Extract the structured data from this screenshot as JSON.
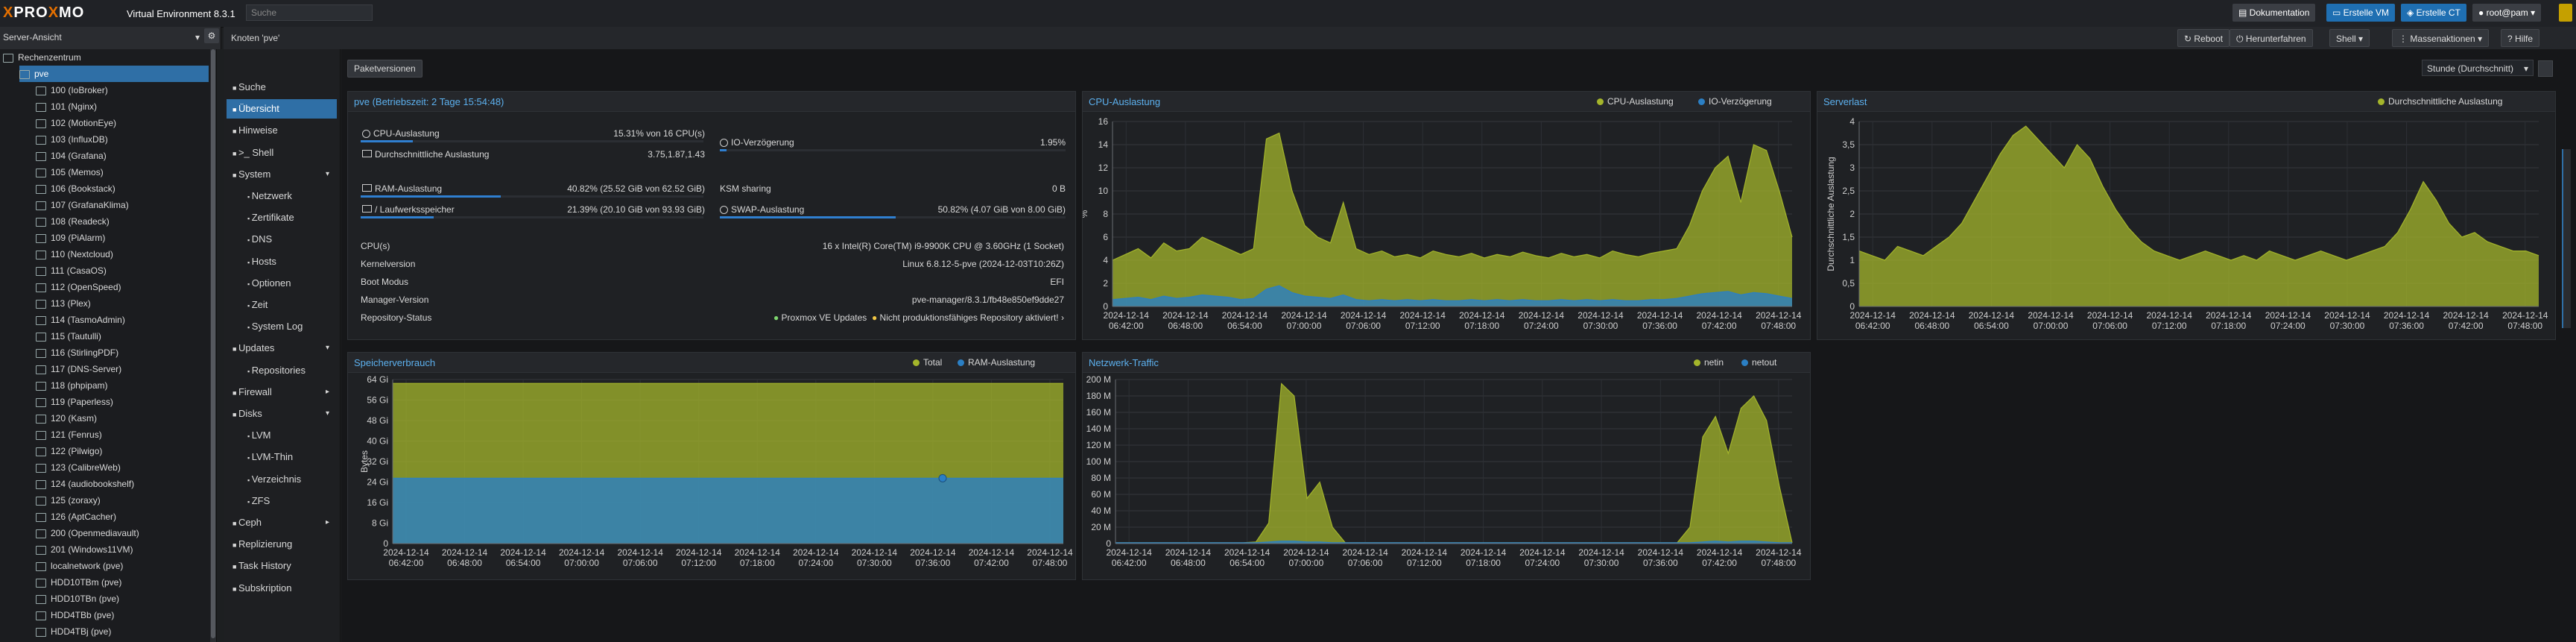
{
  "header": {
    "logo_left": "PRO",
    "logo_x": "X",
    "logo_right": "MO",
    "logo_x2": "X",
    "version": "Virtual Environment 8.3.1",
    "search_placeholder": "Suche",
    "docs": "Dokumentation",
    "create_vm": "Erstelle VM",
    "create_ct": "Erstelle CT",
    "user": "root@pam",
    "view": "Server-Ansicht"
  },
  "tree": [
    {
      "label": "Rechenzentrum",
      "indent": 0
    },
    {
      "label": "pve",
      "indent": 1,
      "selected": true
    },
    {
      "label": "100 (IoBroker)",
      "indent": 2
    },
    {
      "label": "101 (Nginx)",
      "indent": 2
    },
    {
      "label": "102 (MotionEye)",
      "indent": 2
    },
    {
      "label": "103 (InfluxDB)",
      "indent": 2
    },
    {
      "label": "104 (Grafana)",
      "indent": 2
    },
    {
      "label": "105 (Memos)",
      "indent": 2
    },
    {
      "label": "106 (Bookstack)",
      "indent": 2
    },
    {
      "label": "107 (GrafanaKlima)",
      "indent": 2
    },
    {
      "label": "108 (Readeck)",
      "indent": 2
    },
    {
      "label": "109 (PiAlarm)",
      "indent": 2
    },
    {
      "label": "110 (Nextcloud)",
      "indent": 2
    },
    {
      "label": "111 (CasaOS)",
      "indent": 2
    },
    {
      "label": "112 (OpenSpeed)",
      "indent": 2
    },
    {
      "label": "113 (Plex)",
      "indent": 2
    },
    {
      "label": "114 (TasmoAdmin)",
      "indent": 2
    },
    {
      "label": "115 (Tautulli)",
      "indent": 2
    },
    {
      "label": "116 (StirlingPDF)",
      "indent": 2
    },
    {
      "label": "117 (DNS-Server)",
      "indent": 2
    },
    {
      "label": "118 (phpipam)",
      "indent": 2
    },
    {
      "label": "119 (Paperless)",
      "indent": 2
    },
    {
      "label": "120 (Kasm)",
      "indent": 2
    },
    {
      "label": "121 (Fenrus)",
      "indent": 2
    },
    {
      "label": "122 (Pilwigo)",
      "indent": 2
    },
    {
      "label": "123 (CalibreWeb)",
      "indent": 2
    },
    {
      "label": "124 (audiobookshelf)",
      "indent": 2
    },
    {
      "label": "125 (zoraxy)",
      "indent": 2
    },
    {
      "label": "126 (AptCacher)",
      "indent": 2
    },
    {
      "label": "200 (Openmediavault)",
      "indent": 2
    },
    {
      "label": "201 (Windows11VM)",
      "indent": 2
    },
    {
      "label": "localnetwork (pve)",
      "indent": 2
    },
    {
      "label": "HDD10TBm (pve)",
      "indent": 2
    },
    {
      "label": "HDD10TBn (pve)",
      "indent": 2
    },
    {
      "label": "HDD4TBb (pve)",
      "indent": 2
    },
    {
      "label": "HDD4TBj (pve)",
      "indent": 2
    }
  ],
  "nodebar": {
    "title": "Knoten 'pve'",
    "reboot": "Reboot",
    "shutdown": "Herunterfahren",
    "shell": "Shell",
    "bulk": "Massenaktionen",
    "help": "Hilfe"
  },
  "nav": [
    {
      "label": "Suche",
      "sub": false
    },
    {
      "label": "Übersicht",
      "sub": false,
      "selected": true
    },
    {
      "label": "Hinweise",
      "sub": false
    },
    {
      "label": ">_ Shell",
      "sub": false
    },
    {
      "label": "System",
      "sub": false,
      "arrow": "▾"
    },
    {
      "label": "Netzwerk",
      "sub": true
    },
    {
      "label": "Zertifikate",
      "sub": true
    },
    {
      "label": "DNS",
      "sub": true
    },
    {
      "label": "Hosts",
      "sub": true
    },
    {
      "label": "Optionen",
      "sub": true
    },
    {
      "label": "Zeit",
      "sub": true
    },
    {
      "label": "System Log",
      "sub": true
    },
    {
      "label": "Updates",
      "sub": false,
      "arrow": "▾"
    },
    {
      "label": "Repositories",
      "sub": true
    },
    {
      "label": "Firewall",
      "sub": false,
      "arrow": "▸"
    },
    {
      "label": "Disks",
      "sub": false,
      "arrow": "▾"
    },
    {
      "label": "LVM",
      "sub": true
    },
    {
      "label": "LVM-Thin",
      "sub": true
    },
    {
      "label": "Verzeichnis",
      "sub": true
    },
    {
      "label": "ZFS",
      "sub": true
    },
    {
      "label": "Ceph",
      "sub": false,
      "arrow": "▸"
    },
    {
      "label": "Replizierung",
      "sub": false
    },
    {
      "label": "Task History",
      "sub": false
    },
    {
      "label": "Subskription",
      "sub": false
    }
  ],
  "toolbar": {
    "packages": "Paketversionen",
    "timeframe": "Stunde (Durchschnitt)"
  },
  "status": {
    "title": "pve (Betriebszeit: 2 Tage 15:54:48)",
    "cpu_label": "CPU-Auslastung",
    "cpu_value": "15.31% von 16 CPU(s)",
    "cpu_fraction": 0.153,
    "io_label": "IO-Verzögerung",
    "io_value": "1.95%",
    "io_fraction": 0.02,
    "load_label": "Durchschnittliche Auslastung",
    "load_value": "3.75,1.87,1.43",
    "ram_label": "RAM-Auslastung",
    "ram_value": "40.82% (25.52 GiB von 62.52 GiB)",
    "ram_fraction": 0.408,
    "ksm_label": "KSM sharing",
    "ksm_value": "0 B",
    "root_label": "/ Laufwerksspeicher",
    "root_value": "21.39% (20.10 GiB von 93.93 GiB)",
    "root_fraction": 0.214,
    "swap_label": "SWAP-Auslastung",
    "swap_value": "50.82% (4.07 GiB von 8.00 GiB)",
    "swap_fraction": 0.508,
    "cpus_label": "CPU(s)",
    "cpus_value": "16 x Intel(R) Core(TM) i9-9900K CPU @ 3.60GHz (1 Socket)",
    "kernel_label": "Kernelversion",
    "kernel_value": "Linux 6.8.12-5-pve (2024-12-03T10:26Z)",
    "boot_label": "Boot Modus",
    "boot_value": "EFI",
    "manager_label": "Manager-Version",
    "manager_value": "pve-manager/8.3.1/fb48e850ef9dde27",
    "repo_label": "Repository-Status",
    "repo_ok": "Proxmox VE Updates",
    "repo_warn": "Nicht produktionsfähiges Repository aktiviert!"
  },
  "chart_data": [
    {
      "type": "area",
      "title": "CPU-Auslastung",
      "ylabel": "%",
      "ylim": [
        0,
        16
      ],
      "yticks": [
        "0",
        "2",
        "4",
        "6",
        "8",
        "10",
        "12",
        "14",
        "16"
      ],
      "x": [
        "2024-12-14\n06:42:00",
        "2024-12-14\n06:48:00",
        "2024-12-14\n06:54:00",
        "2024-12-14\n07:00:00",
        "2024-12-14\n07:06:00",
        "2024-12-14\n07:12:00",
        "2024-12-14\n07:18:00",
        "2024-12-14\n07:24:00",
        "2024-12-14\n07:30:00",
        "2024-12-14\n07:36:00",
        "2024-12-14\n07:42:00",
        "2024-12-14\n07:48:00"
      ],
      "series": [
        {
          "name": "CPU-Auslastung",
          "color": "#a4b52b",
          "values": [
            4,
            4.5,
            5,
            4.2,
            5.5,
            4.8,
            5,
            6,
            5.5,
            5,
            4.5,
            5,
            14.5,
            15,
            10,
            7,
            6,
            5.5,
            9,
            5,
            4.5,
            4.8,
            4.3,
            4.5,
            4.2,
            4.8,
            4.5,
            4.3,
            4.6,
            4.2,
            4.5,
            4.3,
            4.7,
            4.4,
            4.2,
            4.6,
            4.3,
            4.5,
            4.2,
            4.8,
            4.5,
            4.3,
            4.6,
            4.8,
            5,
            7,
            10,
            12,
            13,
            9,
            14,
            13.5,
            10,
            6
          ]
        },
        {
          "name": "IO-Verzögerung",
          "color": "#2b7fc4",
          "values": [
            0.6,
            0.7,
            0.8,
            0.6,
            0.9,
            0.7,
            0.8,
            1,
            0.9,
            0.8,
            0.6,
            0.7,
            1.5,
            1.8,
            1.2,
            0.9,
            0.8,
            0.7,
            1,
            0.6,
            0.5,
            0.6,
            0.5,
            0.6,
            0.5,
            0.6,
            0.5,
            0.5,
            0.6,
            0.5,
            0.6,
            0.5,
            0.6,
            0.5,
            0.5,
            0.6,
            0.5,
            0.6,
            0.5,
            0.6,
            0.5,
            0.5,
            0.6,
            0.6,
            0.7,
            0.9,
            1.1,
            1.2,
            1.3,
            1,
            1.2,
            1.1,
            0.9,
            0.7
          ]
        }
      ]
    },
    {
      "type": "area",
      "title": "Serverlast",
      "ylabel": "Durchschnittliche Auslastung",
      "ylim": [
        0,
        4
      ],
      "yticks": [
        "0",
        "0,5",
        "1",
        "1,5",
        "2",
        "2,5",
        "3",
        "3,5",
        "4"
      ],
      "x": [
        "2024-12-14\n06:42:00",
        "2024-12-14\n06:48:00",
        "2024-12-14\n06:54:00",
        "2024-12-14\n07:00:00",
        "2024-12-14\n07:06:00",
        "2024-12-14\n07:12:00",
        "2024-12-14\n07:18:00",
        "2024-12-14\n07:24:00",
        "2024-12-14\n07:30:00",
        "2024-12-14\n07:36:00",
        "2024-12-14\n07:42:00",
        "2024-12-14\n07:48:00"
      ],
      "series": [
        {
          "name": "Durchschnittliche Auslastung",
          "color": "#a4b52b",
          "values": [
            1.2,
            1.1,
            1,
            1.3,
            1.2,
            1.1,
            1.3,
            1.5,
            1.8,
            2.3,
            2.8,
            3.3,
            3.7,
            3.9,
            3.6,
            3.3,
            3,
            3.5,
            3.2,
            2.6,
            2.1,
            1.7,
            1.4,
            1.2,
            1.1,
            1,
            1.1,
            1.2,
            1.1,
            1,
            1.1,
            1,
            1.2,
            1.1,
            1,
            1.1,
            1.2,
            1.1,
            1,
            1.1,
            1.2,
            1.3,
            1.6,
            2.1,
            2.7,
            2.3,
            1.8,
            1.5,
            1.6,
            1.4,
            1.3,
            1.2,
            1.2,
            1.1
          ]
        }
      ]
    },
    {
      "type": "area",
      "title": "Speicherverbrauch",
      "ylabel": "Bytes",
      "ylim": [
        0,
        64
      ],
      "yticks": [
        "0",
        "8 Gi",
        "16 Gi",
        "24 Gi",
        "32 Gi",
        "40 Gi",
        "48 Gi",
        "56 Gi",
        "64 Gi"
      ],
      "x": [
        "2024-12-14\n06:42:00",
        "2024-12-14\n06:48:00",
        "2024-12-14\n06:54:00",
        "2024-12-14\n07:00:00",
        "2024-12-14\n07:06:00",
        "2024-12-14\n07:12:00",
        "2024-12-14\n07:18:00",
        "2024-12-14\n07:24:00",
        "2024-12-14\n07:30:00",
        "2024-12-14\n07:36:00",
        "2024-12-14\n07:42:00",
        "2024-12-14\n07:48:00"
      ],
      "series": [
        {
          "name": "Total",
          "color": "#a4b52b",
          "values": [
            62.5,
            62.5,
            62.5,
            62.5,
            62.5,
            62.5,
            62.5,
            62.5,
            62.5,
            62.5,
            62.5,
            62.5
          ]
        },
        {
          "name": "RAM-Auslastung",
          "color": "#2b7fc4",
          "values": [
            25.5,
            25.5,
            25.5,
            25.5,
            25.5,
            25.5,
            25.5,
            25.5,
            25.5,
            25.5,
            25.5,
            25.5
          ]
        }
      ]
    },
    {
      "type": "area",
      "title": "Netzwerk-Traffic",
      "ylim": [
        0,
        200
      ],
      "yticks": [
        "0",
        "20 M",
        "40 M",
        "60 M",
        "80 M",
        "100 M",
        "120 M",
        "140 M",
        "160 M",
        "180 M",
        "200 M"
      ],
      "x": [
        "2024-12-14\n06:42:00",
        "2024-12-14\n06:48:00",
        "2024-12-14\n06:54:00",
        "2024-12-14\n07:00:00",
        "2024-12-14\n07:06:00",
        "2024-12-14\n07:12:00",
        "2024-12-14\n07:18:00",
        "2024-12-14\n07:24:00",
        "2024-12-14\n07:30:00",
        "2024-12-14\n07:36:00",
        "2024-12-14\n07:42:00",
        "2024-12-14\n07:48:00"
      ],
      "series": [
        {
          "name": "netin",
          "color": "#a4b52b",
          "values": [
            1,
            1,
            1,
            1,
            1,
            1,
            1,
            1,
            1,
            1,
            1,
            2,
            25,
            195,
            180,
            55,
            75,
            20,
            1,
            1,
            1,
            1,
            1,
            1,
            1,
            1,
            1,
            1,
            1,
            1,
            1,
            1,
            1,
            1,
            1,
            1,
            1,
            1,
            1,
            1,
            1,
            1,
            1,
            1,
            1,
            20,
            130,
            155,
            110,
            165,
            180,
            150,
            70,
            1
          ]
        },
        {
          "name": "netout",
          "color": "#2b7fc4",
          "values": [
            1,
            1,
            1,
            1,
            1,
            1,
            1,
            1,
            1,
            1,
            1,
            1,
            2,
            3,
            3,
            2,
            2,
            1,
            1,
            1,
            1,
            1,
            1,
            1,
            1,
            1,
            1,
            1,
            1,
            1,
            1,
            1,
            1,
            1,
            1,
            1,
            1,
            1,
            1,
            1,
            1,
            1,
            1,
            1,
            1,
            1,
            2,
            3,
            2,
            3,
            3,
            2,
            1,
            1
          ]
        }
      ]
    }
  ]
}
